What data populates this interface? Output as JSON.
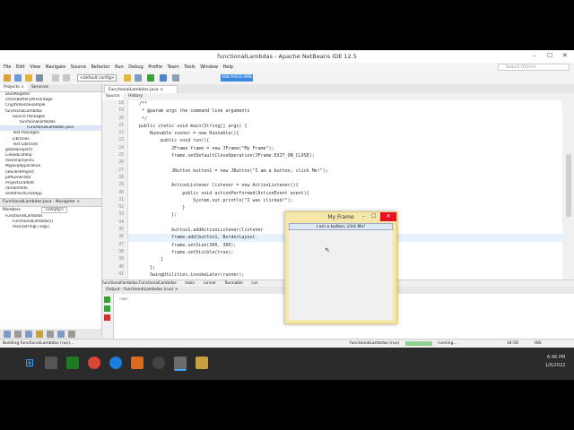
{
  "window": {
    "title": "functionalLambdas - Apache NetBeans IDE 12.5",
    "controls": [
      "–",
      "☐",
      "✕"
    ]
  },
  "menu": [
    "File",
    "Edit",
    "View",
    "Navigate",
    "Source",
    "Refactor",
    "Run",
    "Debug",
    "Profile",
    "Team",
    "Tools",
    "Window",
    "Help"
  ],
  "toolbar": {
    "config": "<default config>",
    "memory": "468.9/616.0MB",
    "search_placeholder": "Search (Ctrl+I)"
  },
  "projects": {
    "tabs": [
      "Projects ×",
      "Services"
    ],
    "items": [
      "asseRegister",
      "checkBatteryPercentage",
      "CryptoVoiceExample",
      "functionalLambdas",
      "Source Packages",
      "functionallambdas",
      "FunctionalLambdas.java",
      "Test Packages",
      "Libraries",
      "Test Libraries",
      "globalproject1",
      "LinkedListImp",
      "mavenproject1",
      "MyJavaApplication",
      "newTestProject",
      "pdfGenerator",
      "ProjectGradleIt",
      "randomInfo",
      "redditTechChatApp"
    ]
  },
  "navigator": {
    "header": "FunctionalLambdas.java - Navigator ×",
    "members_label": "Members",
    "filter": "<empty>",
    "items": [
      "FunctionalLambdas",
      "FunctionalLambdas()",
      "main(String[] args)"
    ]
  },
  "editor": {
    "tab": "FunctionalLambdas.java ×",
    "source_tab": "Source",
    "history_tab": "History",
    "line_numbers": [
      "18",
      "19",
      "20",
      "21",
      "22",
      "23",
      "24",
      "25",
      "26",
      "27",
      "28",
      "29",
      "30",
      "31",
      "32",
      "33",
      "34",
      "35",
      "36",
      "37",
      "38",
      "39",
      "40",
      "41"
    ],
    "lines": [
      "    /**",
      "     * @param args the command line arguments",
      "     */",
      "    public static void main(String[] args) {",
      "        Runnable runner = new Runnable(){",
      "            public void run(){",
      "                JFrame frame = new JFrame(\"My Frame\");",
      "                frame.setDefaultCloseOperation(JFrame.EXIT_ON_CLOSE);",
      "",
      "                JButton button1 = new JButton(\"I am a button, click Me!\");",
      "",
      "                ActionListener listener = new ActionListener(){",
      "                    public void actionPerformed(ActionEvent event){",
      "                        System.out.println(\"I was clicked!\");",
      "                    }",
      "                };",
      "",
      "                button1.addActionListener(listener",
      "                frame.add(button1, BorderLayout.",
      "                frame.setSize(300, 300);",
      "                frame.setVisible(true);",
      "            }",
      "        };",
      "        SwingUtilities.invokeLater(runner);"
    ]
  },
  "breadcrumbs": [
    "functionallambdas.FunctionalLambdas",
    "main",
    "runner",
    "Runnable",
    "run"
  ],
  "output": {
    "header": "Output - functionalLambdas (run) ×",
    "text": "run:"
  },
  "status": {
    "left": "Building functionalLambdas (run)...",
    "center": "functionalLambdas (run)",
    "running": "running...",
    "position": "34:56",
    "mode": "INS"
  },
  "jframe": {
    "title": "My Frame",
    "button": "I am a button, click Me!"
  },
  "taskbar": {
    "time": "6:46 PM",
    "date": "1/6/2022"
  },
  "colors": {
    "accent": "#3b88e0",
    "frame_border": "#f6e6a9",
    "close_red": "#e81123",
    "taskbar": "#2b2b2b"
  }
}
